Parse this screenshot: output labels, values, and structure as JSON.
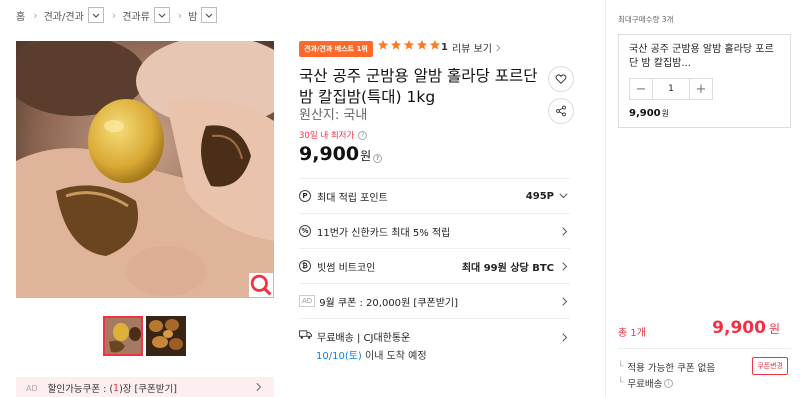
{
  "breadcrumb": {
    "items": [
      "홈",
      "견과/견과",
      "견과류",
      "밤"
    ]
  },
  "product": {
    "badge": "견과/견과 베스트 1위",
    "rating_stars": 5,
    "review_count": "1",
    "review_label": "리뷰 보기",
    "title": "국산 공주 군밤용 알밤 홀라당 포르단 밤 칼집밤(특대) 1kg",
    "origin": "원산지: 국내",
    "lowest_note": "30일 내 최저가",
    "price": "9,900",
    "price_unit": "원"
  },
  "info_rows": {
    "points_label": "최대 적립 포인트",
    "points_value": "495P",
    "card_label": "11번가 신한카드 최대 5% 적립",
    "bitcoin_label": "빗썸 비트코인",
    "bitcoin_value": "최대 99원 상당 BTC",
    "ad_tag": "AD",
    "coupon_label": "9월 쿠폰 : 20,000원 [쿠폰받기]",
    "shipping_label": "무료배송 | CJ대한통운",
    "shipping_date": "10/10(토)",
    "shipping_suffix": " 이내 도착 예정"
  },
  "coupon_bar": {
    "ad": "AD",
    "prefix": "할인가능쿠폰 : (",
    "count": "1",
    "suffix": ")장 [쿠폰받기]"
  },
  "side_panel": {
    "heading": "최대구매수량 3개",
    "option_name": "국산 공주 군밤용 알밤 홀라당 포르단 밤 칼집밤...",
    "quantity": "1",
    "option_price": "9,900",
    "option_price_unit": "원",
    "total_label": "총 1개",
    "total_price": "9,900",
    "total_unit": "원",
    "coupon_none": "적용 가능한 쿠폰 없음",
    "coupon_change": "쿠폰변경",
    "free_shipping": "무료배송"
  },
  "colors": {
    "accent_red": "#f43142",
    "badge_orange": "#ff6a2b",
    "star_orange": "#ff7a21",
    "link_blue": "#0b83e6"
  }
}
